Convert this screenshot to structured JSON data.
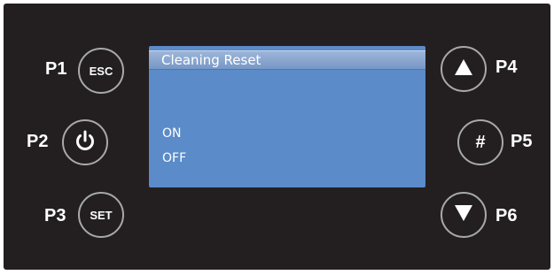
{
  "labels": {
    "p1": "P1",
    "p2": "P2",
    "p3": "P3",
    "p4": "P4",
    "p5": "P5",
    "p6": "P6"
  },
  "buttons": {
    "esc": "ESC",
    "power_icon": "power-icon",
    "set": "SET",
    "up_icon": "triangle-up-icon",
    "hash": "#",
    "down_icon": "triangle-down-icon"
  },
  "screen": {
    "title": "Cleaning Reset",
    "options": [
      "ON",
      "OFF"
    ]
  },
  "colors": {
    "panel_background": "#231f20",
    "button_border": "#a7a9ac",
    "screen_background": "#5b8bc9",
    "text": "#ffffff"
  }
}
